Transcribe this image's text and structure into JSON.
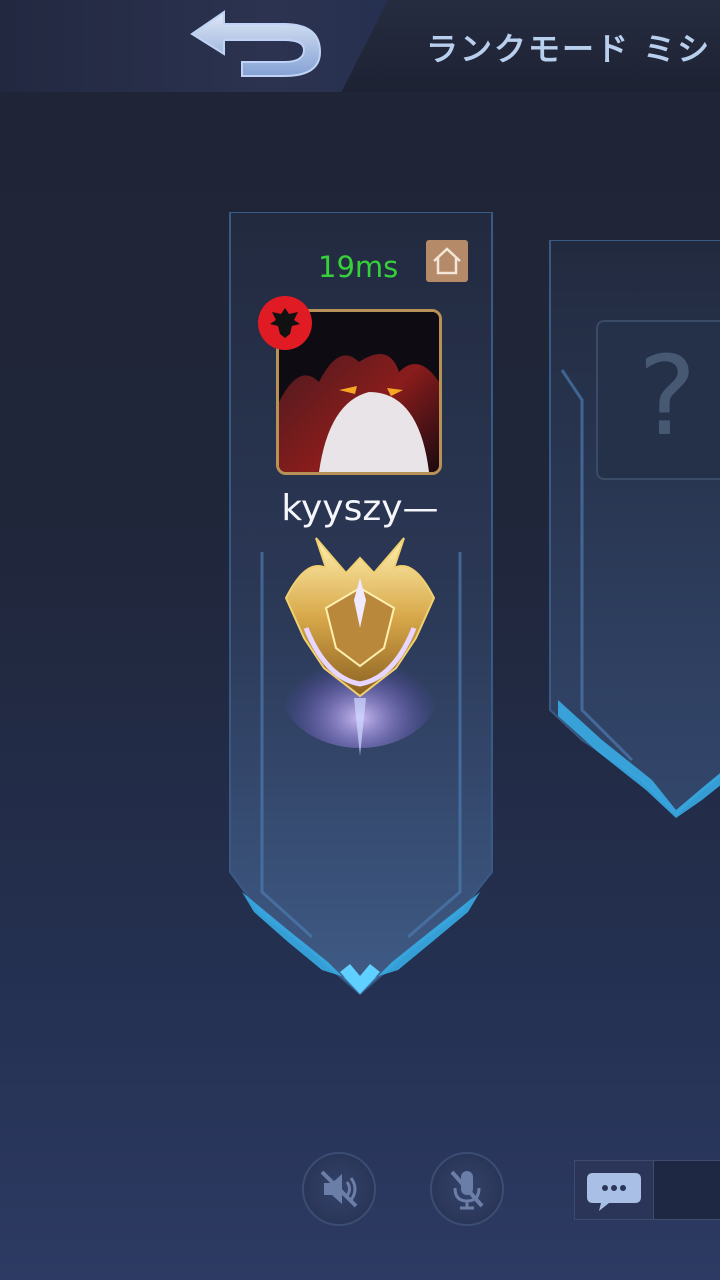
{
  "header": {
    "title": "ランクモード ミシ"
  },
  "player": {
    "ping": "19ms",
    "name": "kyyszy—"
  },
  "slot2": {
    "placeholder": "?"
  },
  "icons": {
    "back": "back-arrow-icon",
    "home": "home-icon",
    "flag": "albania-flag-icon",
    "speaker_muted": "speaker-muted-icon",
    "mic_muted": "mic-muted-icon",
    "chat": "chat-bubble-icon"
  },
  "colors": {
    "ping": "#36d03a",
    "title": "#b9cfee",
    "banner_glow": "#3ec3f5"
  }
}
